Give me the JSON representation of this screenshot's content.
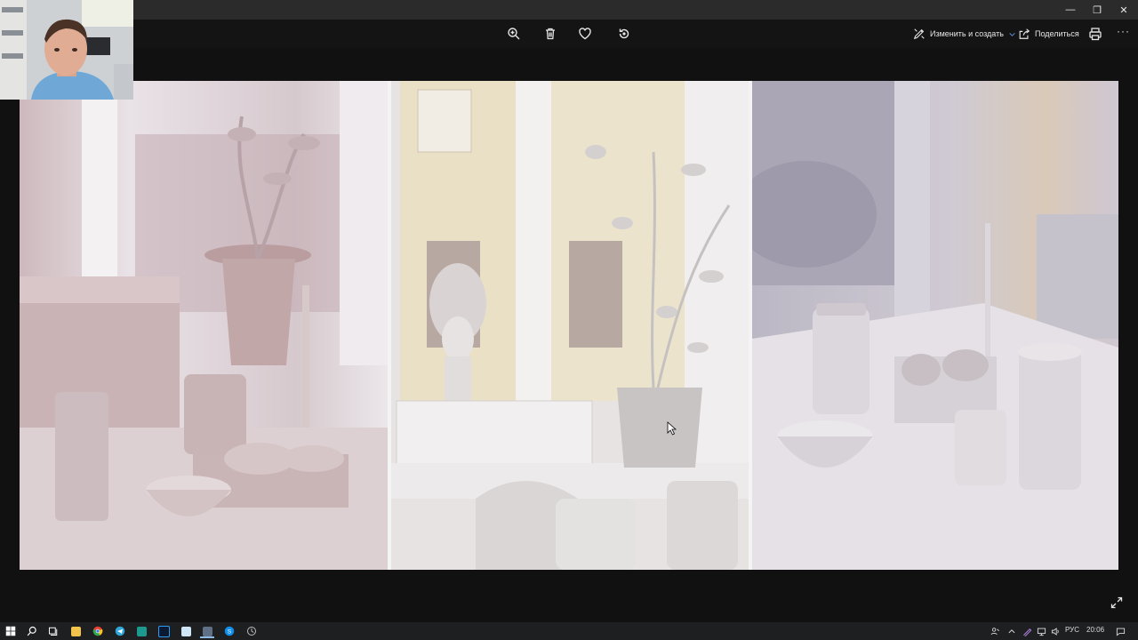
{
  "window": {
    "controls": {
      "minimize": "—",
      "maximize": "❐",
      "close": "✕"
    }
  },
  "toolbar": {
    "icons": [
      "zoom-in-icon",
      "delete-icon",
      "favorite-icon",
      "rotate-icon"
    ],
    "edit_create_label": "Изменить и создать",
    "share_label": "Поделиться",
    "more_label": "···"
  },
  "viewer": {
    "panel_count": 3,
    "colors": {
      "background": "#111111",
      "toolbar": "#141414",
      "titlebar": "#2b2b2b",
      "clay": "#e3dde1"
    }
  },
  "taskbar": {
    "apps": [
      "start",
      "search",
      "task-view",
      "file-explorer",
      "chrome",
      "telegram",
      "3ds-max",
      "photoshop",
      "notes",
      "photos",
      "skype",
      "other-app"
    ],
    "tray": {
      "language": "РУС",
      "time": "20:06"
    }
  }
}
